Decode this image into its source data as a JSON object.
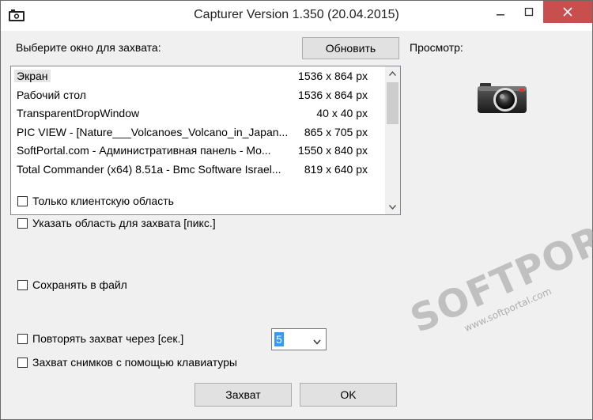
{
  "window": {
    "title": "Capturer Version 1.350 (20.04.2015)"
  },
  "source": {
    "label": "Выберите окно для захвата:",
    "refresh_button": "Обновить",
    "items": [
      {
        "name": "Экран",
        "size": "1536 x 864 px",
        "selected": true
      },
      {
        "name": "Рабочий стол",
        "size": "1536 x 864 px",
        "selected": false
      },
      {
        "name": "TransparentDropWindow",
        "size": "40 x 40 px",
        "selected": false
      },
      {
        "name": "PIC VIEW  - [Nature___Volcanoes_Volcano_in_Japan...",
        "size": "865 x 705 px",
        "selected": false
      },
      {
        "name": "SoftPortal.com - Административная панель - Mo...",
        "size": "1550 x 840 px",
        "selected": false
      },
      {
        "name": "Total Commander (x64) 8.51a - Bmc Software Israel...",
        "size": "819 x 640 px",
        "selected": false
      }
    ]
  },
  "preview": {
    "label": "Просмотр:",
    "icon": "camera-icon"
  },
  "options": {
    "client_area": "Только клиентскую область",
    "specify_area": "Указать область для захвата [пикс.]",
    "save_to_file": "Сохранять в файл",
    "repeat_capture": "Повторять захват через [сек.]",
    "repeat_seconds": "5",
    "keyboard_capture": "Захват снимков с помощью клавиатуры"
  },
  "footer": {
    "capture_button": "Захват",
    "ok_button": "OK"
  },
  "watermark": {
    "brand": "SOFTPORTAL",
    "url": "www.softportal.com",
    "tm": "TM"
  }
}
